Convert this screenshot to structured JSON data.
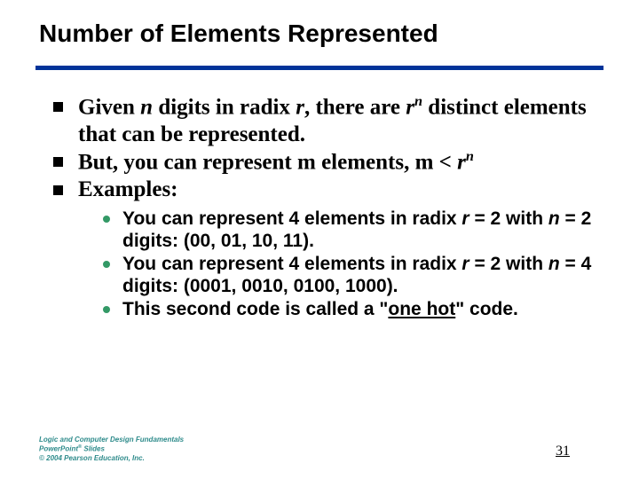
{
  "title": "Number of Elements Represented",
  "bullets": {
    "b1a": "Given ",
    "b1b": "n",
    "b1c": " digits in radix ",
    "b1d": "r",
    "b1e": ", there are ",
    "b1f": "r",
    "b1g": "n",
    "b1h": " distinct elements that can be represented.",
    "b2a": "But, you can represent m elements, m < ",
    "b2b": "r",
    "b2c": "n",
    "b3": "Examples:"
  },
  "sub": {
    "s1a": "You can represent 4 elements in radix ",
    "s1b": "r",
    "s1c": " = 2 with ",
    "s1d": "n",
    "s1e": " = 2 digits: (00, 01, 10, 11).",
    "s2a": "You can represent 4 elements in radix ",
    "s2b": "r",
    "s2c": " = 2 with ",
    "s2d": "n",
    "s2e": " = 4 digits: (0001, 0010, 0100, 1000).",
    "s3a": "This second code is called a \"",
    "s3b": "one hot",
    "s3c": "\" code."
  },
  "footer": {
    "line1a": "Logic and Computer Design Fundamentals",
    "line2a": "PowerPoint",
    "line2b": "®",
    "line2c": " Slides",
    "line3": "© 2004 Pearson Education, Inc."
  },
  "page": "31"
}
